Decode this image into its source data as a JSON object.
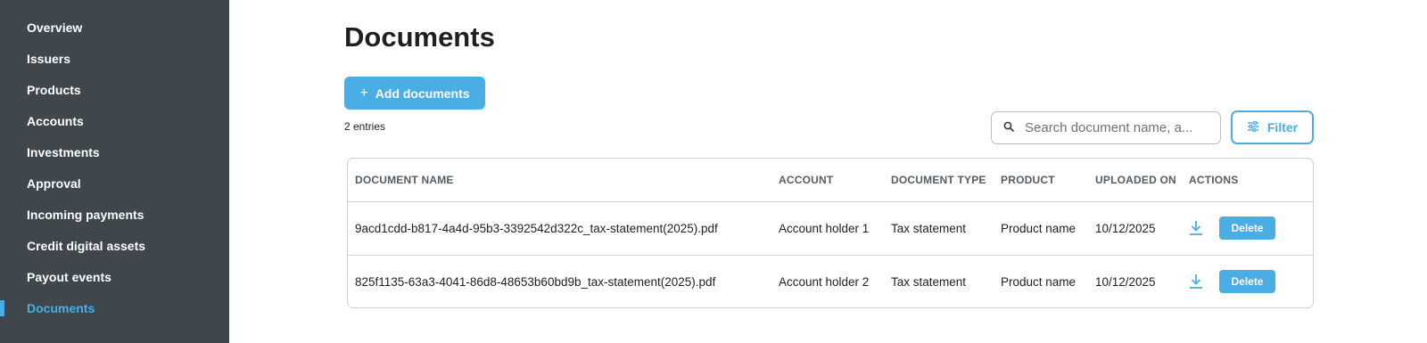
{
  "sidebar": {
    "items": [
      {
        "label": "Overview"
      },
      {
        "label": "Issuers"
      },
      {
        "label": "Products"
      },
      {
        "label": "Accounts"
      },
      {
        "label": "Investments"
      },
      {
        "label": "Approval"
      },
      {
        "label": "Incoming payments"
      },
      {
        "label": "Credit digital assets"
      },
      {
        "label": "Payout events"
      },
      {
        "label": "Documents",
        "active": true
      }
    ]
  },
  "main": {
    "title": "Documents",
    "add_button": {
      "icon": "plus-icon",
      "label": "Add documents"
    },
    "entries_count": "2 entries",
    "search": {
      "placeholder": "Search document name, a...",
      "value": "",
      "icon": "search-icon"
    },
    "filter_button": {
      "icon": "sliders-icon",
      "label": "Filter"
    }
  },
  "table": {
    "columns": [
      "DOCUMENT NAME",
      "ACCOUNT",
      "DOCUMENT TYPE",
      "PRODUCT",
      "UPLOADED ON",
      "ACTIONS"
    ],
    "rows": [
      {
        "document_name": "9acd1cdd-b817-4a4d-95b3-3392542d322c_tax-statement(2025).pdf",
        "account": "Account holder 1",
        "document_type": "Tax statement",
        "product": "Product name",
        "uploaded_on": "10/12/2025",
        "download_icon": "download-icon",
        "delete_label": "Delete"
      },
      {
        "document_name": "825f1135-63a3-4041-86d8-48653b60bd9b_tax-statement(2025).pdf",
        "account": "Account holder 2",
        "document_type": "Tax statement",
        "product": "Product name",
        "uploaded_on": "10/12/2025",
        "download_icon": "download-icon",
        "delete_label": "Delete"
      }
    ]
  },
  "colors": {
    "sidebar_bg": "#3f474d",
    "accent": "#4aaee4",
    "border": "#cdd2d6"
  }
}
